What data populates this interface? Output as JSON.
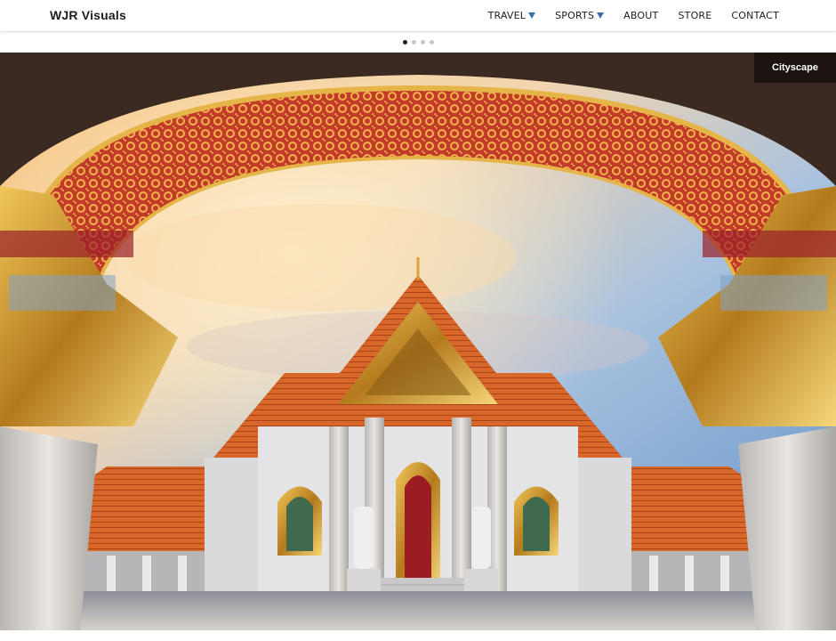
{
  "brand": "WJR Visuals",
  "nav": [
    {
      "label": "TRAVEL",
      "dropdown": true
    },
    {
      "label": "SPORTS",
      "dropdown": true
    },
    {
      "label": "ABOUT",
      "dropdown": false
    },
    {
      "label": "STORE",
      "dropdown": false
    },
    {
      "label": "CONTACT",
      "dropdown": false
    }
  ],
  "slider": {
    "slide_count": 4,
    "active_index": 0,
    "caption": "Cityscape"
  },
  "colors": {
    "accent_caret": "#3a6fa8",
    "text": "#1d1d1d"
  }
}
